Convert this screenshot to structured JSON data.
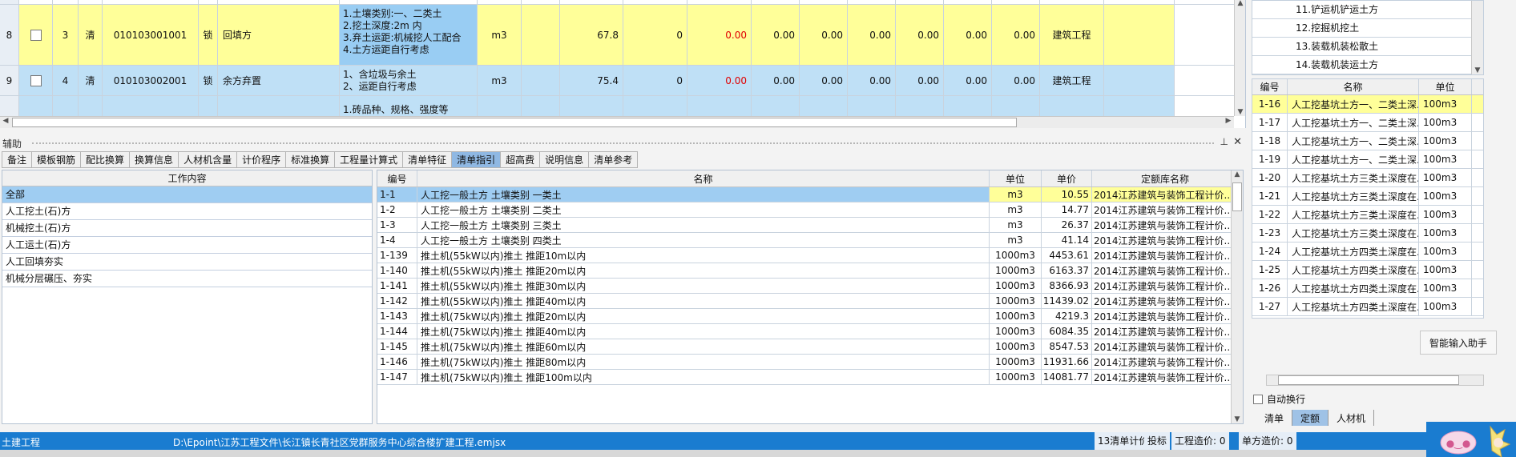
{
  "bill": {
    "rows": [
      {
        "rownum": "8",
        "seq": "3",
        "type": "清",
        "code": "010103001001",
        "lock": "锁",
        "name": "回填方",
        "features": [
          "1.土壤类别:一、二类土",
          "2.挖土深度:2m 内",
          "3.弃土运距:机械挖人工配合",
          "4.土方运距自行考虑"
        ],
        "unit": "m3",
        "qty": "67.8",
        "v1": "0",
        "v2": "0.00",
        "v3": "0.00",
        "v4": "0.00",
        "v5": "0.00",
        "v6": "0.00",
        "v7": "0.00",
        "v8": "0.00",
        "major": "建筑工程"
      },
      {
        "rownum": "9",
        "seq": "4",
        "type": "清",
        "code": "010103002001",
        "lock": "锁",
        "name": "余方弃置",
        "features": [
          "1、含垃圾与余土",
          "2、运距自行考虑"
        ],
        "unit": "m3",
        "qty": "75.4",
        "v1": "0",
        "v2": "0.00",
        "v3": "0.00",
        "v4": "0.00",
        "v5": "0.00",
        "v6": "0.00",
        "v7": "0.00",
        "v8": "0.00",
        "major": "建筑工程"
      }
    ],
    "partial_next_feature": "1.砖品种、规格、强度等"
  },
  "aux": {
    "title": "辅助",
    "pin": "⊥",
    "close": "✕"
  },
  "tabs": [
    "备注",
    "模板钢筋",
    "配比换算",
    "换算信息",
    "人材机含量",
    "计价程序",
    "标准换算",
    "工程量计算式",
    "清单特征",
    "清单指引",
    "超高费",
    "说明信息",
    "清单参考"
  ],
  "active_tab": "清单指引",
  "work": {
    "header": "工作内容",
    "items": [
      "全部",
      "人工挖土(石)方",
      "机械挖土(石)方",
      "人工运土(石)方",
      "人工回填夯实",
      "机械分层碾压、夯实"
    ]
  },
  "quota": {
    "headers": {
      "code": "编号",
      "name": "名称",
      "unit": "单位",
      "price": "单价",
      "lib": "定额库名称"
    },
    "rows": [
      {
        "code": "1-1",
        "name": "人工挖一般土方 土壤类别 一类土",
        "unit": "m3",
        "price": "10.55",
        "lib": "2014江苏建筑与装饰工程计价..."
      },
      {
        "code": "1-2",
        "name": "人工挖一般土方 土壤类别 二类土",
        "unit": "m3",
        "price": "14.77",
        "lib": "2014江苏建筑与装饰工程计价..."
      },
      {
        "code": "1-3",
        "name": "人工挖一般土方 土壤类别 三类土",
        "unit": "m3",
        "price": "26.37",
        "lib": "2014江苏建筑与装饰工程计价..."
      },
      {
        "code": "1-4",
        "name": "人工挖一般土方 土壤类别 四类土",
        "unit": "m3",
        "price": "41.14",
        "lib": "2014江苏建筑与装饰工程计价..."
      },
      {
        "code": "1-139",
        "name": "推土机(55kW以内)推土 推距10m以内",
        "unit": "1000m3",
        "price": "4453.61",
        "lib": "2014江苏建筑与装饰工程计价..."
      },
      {
        "code": "1-140",
        "name": "推土机(55kW以内)推土 推距20m以内",
        "unit": "1000m3",
        "price": "6163.37",
        "lib": "2014江苏建筑与装饰工程计价..."
      },
      {
        "code": "1-141",
        "name": "推土机(55kW以内)推土 推距30m以内",
        "unit": "1000m3",
        "price": "8366.93",
        "lib": "2014江苏建筑与装饰工程计价..."
      },
      {
        "code": "1-142",
        "name": "推土机(55kW以内)推土 推距40m以内",
        "unit": "1000m3",
        "price": "11439.02",
        "lib": "2014江苏建筑与装饰工程计价..."
      },
      {
        "code": "1-143",
        "name": "推土机(75kW以内)推土 推距20m以内",
        "unit": "1000m3",
        "price": "4219.3",
        "lib": "2014江苏建筑与装饰工程计价..."
      },
      {
        "code": "1-144",
        "name": "推土机(75kW以内)推土 推距40m以内",
        "unit": "1000m3",
        "price": "6084.35",
        "lib": "2014江苏建筑与装饰工程计价..."
      },
      {
        "code": "1-145",
        "name": "推土机(75kW以内)推土 推距60m以内",
        "unit": "1000m3",
        "price": "8547.53",
        "lib": "2014江苏建筑与装饰工程计价..."
      },
      {
        "code": "1-146",
        "name": "推土机(75kW以内)推土 推距80m以内",
        "unit": "1000m3",
        "price": "11931.66",
        "lib": "2014江苏建筑与装饰工程计价..."
      },
      {
        "code": "1-147",
        "name": "推土机(75kW以内)推土 推距100m以内",
        "unit": "1000m3",
        "price": "14081.77",
        "lib": "2014江苏建筑与装饰工程计价..."
      }
    ]
  },
  "right": {
    "top_items": [
      "11.铲运机铲运土方",
      "12.挖掘机挖土",
      "13.装载机装松散土",
      "14.装载机装运土方"
    ],
    "list_headers": {
      "code": "编号",
      "name": "名称",
      "unit": "单位"
    },
    "list_rows": [
      {
        "code": "1-16",
        "name": "人工挖基坑土方一、二类土深...",
        "unit": "100m3"
      },
      {
        "code": "1-17",
        "name": "人工挖基坑土方一、二类土深...",
        "unit": "100m3"
      },
      {
        "code": "1-18",
        "name": "人工挖基坑土方一、二类土深...",
        "unit": "100m3"
      },
      {
        "code": "1-19",
        "name": "人工挖基坑土方一、二类土深...",
        "unit": "100m3"
      },
      {
        "code": "1-20",
        "name": "人工挖基坑土方三类土深度在...",
        "unit": "100m3"
      },
      {
        "code": "1-21",
        "name": "人工挖基坑土方三类土深度在...",
        "unit": "100m3"
      },
      {
        "code": "1-22",
        "name": "人工挖基坑土方三类土深度在...",
        "unit": "100m3"
      },
      {
        "code": "1-23",
        "name": "人工挖基坑土方三类土深度在...",
        "unit": "100m3"
      },
      {
        "code": "1-24",
        "name": "人工挖基坑土方四类土深度在...",
        "unit": "100m3"
      },
      {
        "code": "1-25",
        "name": "人工挖基坑土方四类土深度在...",
        "unit": "100m3"
      },
      {
        "code": "1-26",
        "name": "人工挖基坑土方四类土深度在...",
        "unit": "100m3"
      },
      {
        "code": "1-27",
        "name": "人工挖基坑土方四类土深度在...",
        "unit": "100m3"
      }
    ],
    "smart_button": "智能输入助手",
    "autowrap_label": "自动换行",
    "bottom_tabs": [
      "清单",
      "定额",
      "人材机"
    ],
    "active_bottom_tab": "定额"
  },
  "status": {
    "major": "土建工程",
    "path": "D:\\Epoint\\江苏工程文件\\长江镇长青社区党群服务中心综合楼扩建工程.emjsx",
    "mode": "13清单计价",
    "bid": "投标",
    "total": "工程造价: 0",
    "unit_total": "单方造价: 0"
  },
  "colors": {
    "selection_blue": "#9fcdf2",
    "selection_yellow": "#ffff99",
    "status_blue": "#1a7cd0",
    "red_value": "#e00000"
  }
}
